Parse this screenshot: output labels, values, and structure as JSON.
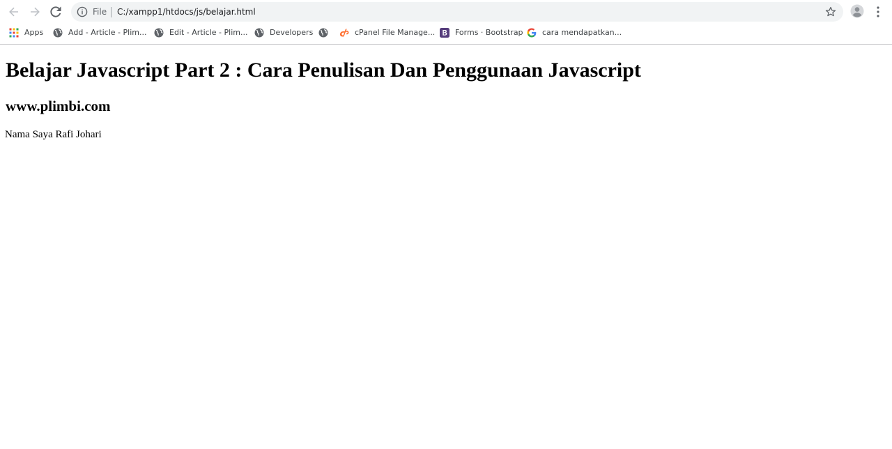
{
  "toolbar": {
    "back_icon": "arrow-left-icon",
    "forward_icon": "arrow-right-icon",
    "reload_icon": "reload-icon",
    "omnibox": {
      "info_icon": "info-icon",
      "scheme_label": "File",
      "url": "C:/xampp1/htdocs/js/belajar.html",
      "bookmark_star_icon": "star-outline-icon"
    },
    "profile_icon": "account-circle-icon",
    "menu_icon": "kebab-menu-icon"
  },
  "bookmarks": [
    {
      "label": "Apps",
      "icon": "apps-grid-icon"
    },
    {
      "label": "Add - Article - Plim...",
      "icon": "globe-icon"
    },
    {
      "label": "Edit - Article - Plim...",
      "icon": "globe-icon"
    },
    {
      "label": "Developers",
      "icon": "globe-icon"
    },
    {
      "label": "",
      "icon": "globe-icon"
    },
    {
      "label": "cPanel File Manage...",
      "icon": "cpanel-icon"
    },
    {
      "label": "Forms · Bootstrap",
      "icon": "bootstrap-icon"
    },
    {
      "label": "cara mendapatkan...",
      "icon": "google-icon"
    }
  ],
  "page": {
    "heading": "Belajar Javascript Part 2 : Cara Penulisan Dan Penggunaan Javascript",
    "subheading": "www.plimbi.com",
    "paragraph": "Nama Saya Rafi Johari"
  },
  "colors": {
    "omnibox_bg": "#f1f3f4",
    "icon_gray": "#5f6368",
    "cpanel_orange": "#ff6c2c",
    "bootstrap_purple": "#563d7c"
  }
}
